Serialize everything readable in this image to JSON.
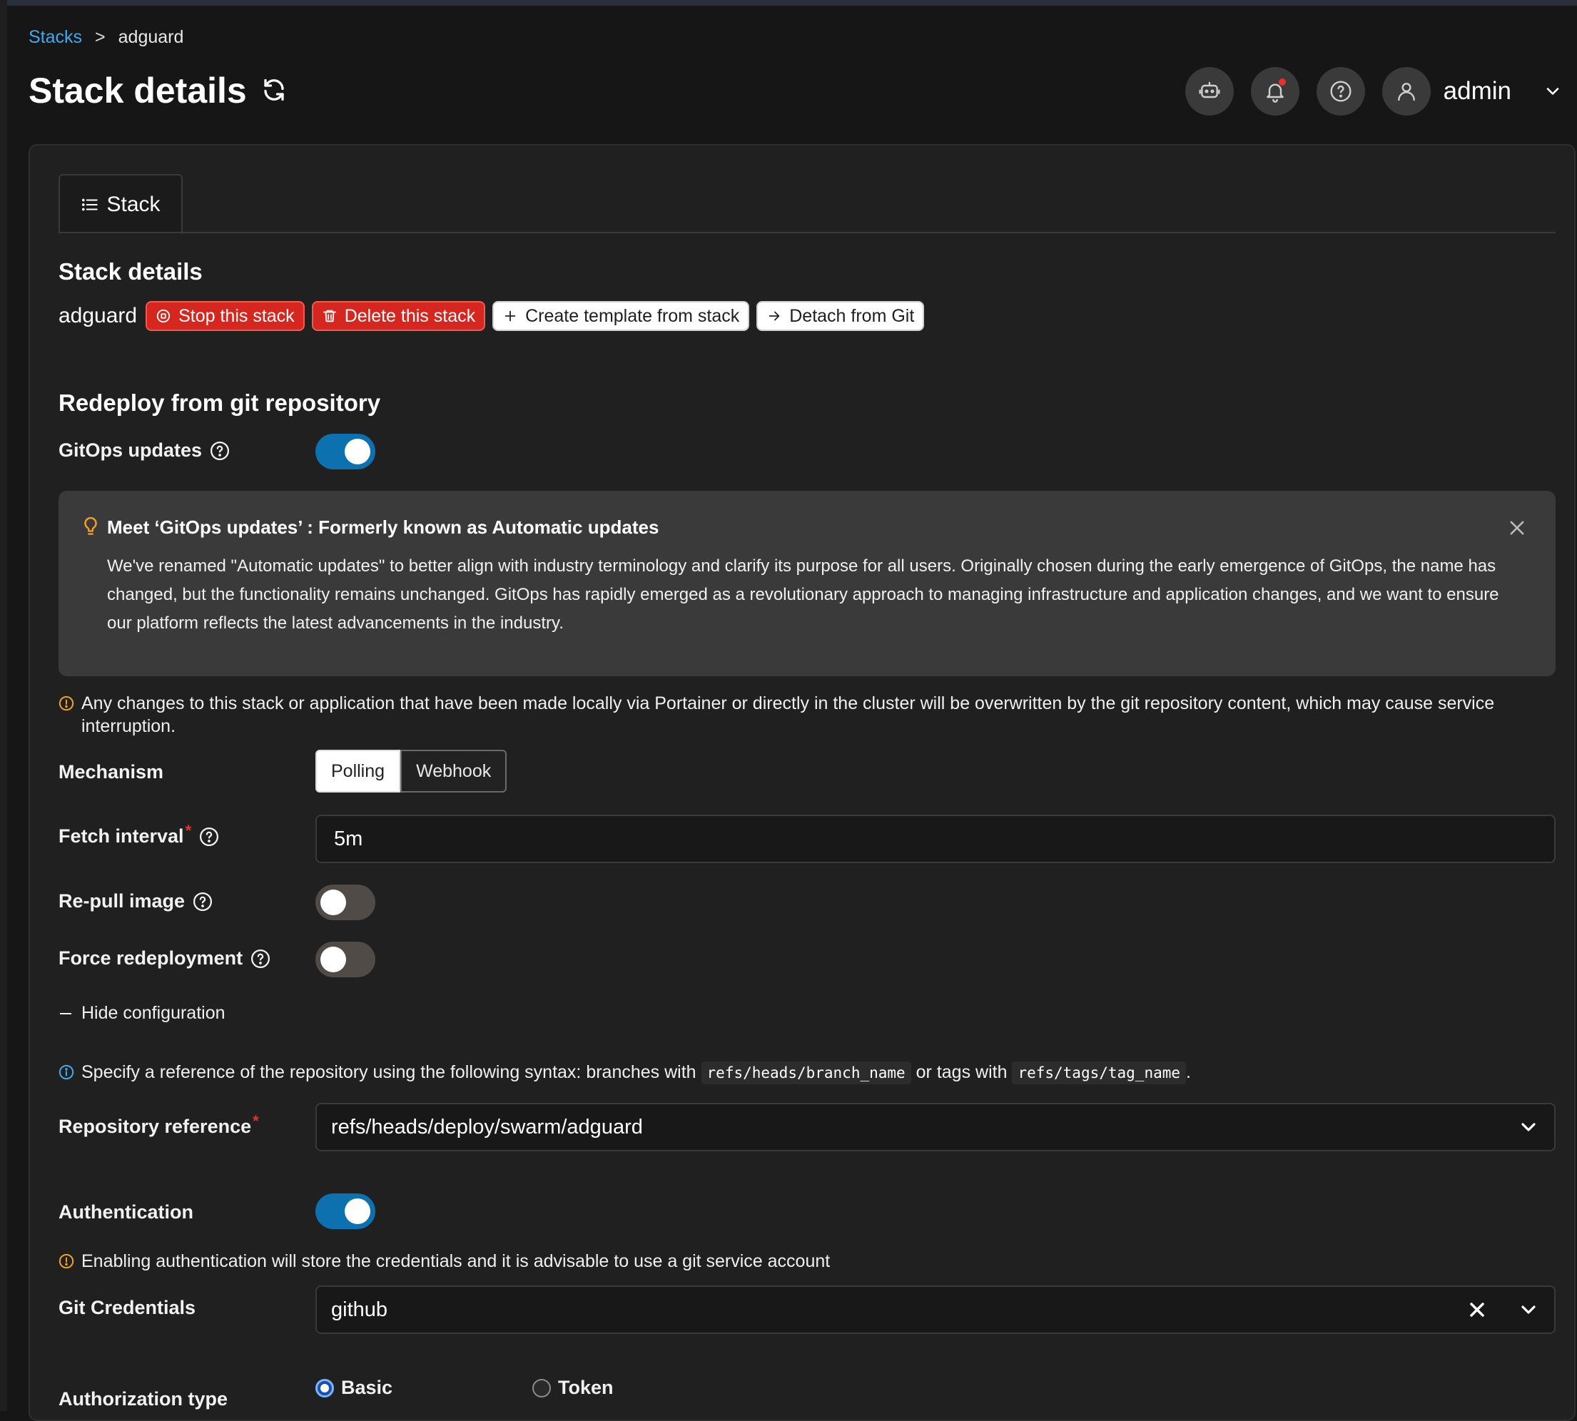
{
  "breadcrumb": {
    "parent": "Stacks",
    "separator": ">",
    "current": "adguard"
  },
  "page": {
    "title": "Stack details"
  },
  "user": {
    "name": "admin"
  },
  "tabs": [
    {
      "label": "Stack"
    }
  ],
  "stack": {
    "section_title": "Stack details",
    "name": "adguard",
    "buttons": {
      "stop": "Stop this stack",
      "delete": "Delete this stack",
      "template": "Create template from stack",
      "detach": "Detach from Git"
    }
  },
  "redeploy": {
    "title": "Redeploy from git repository",
    "gitops_label": "GitOps updates",
    "gitops_enabled": true,
    "info": {
      "title": "Meet ‘GitOps updates’ : Formerly known as Automatic updates",
      "body": "We've renamed \"Automatic updates\" to better align with industry terminology and clarify its purpose for all users. Originally chosen during the early emergence of GitOps, the name has changed, but the functionality remains unchanged. GitOps has rapidly emerged as a revolutionary approach to managing infrastructure and application changes, and we want to ensure our platform reflects the latest advancements in the industry."
    },
    "warning": "Any changes to this stack or application that have been made locally via Portainer or directly in the cluster will be overwritten by the git repository content, which may cause service interruption.",
    "mechanism_label": "Mechanism",
    "mechanism_options": [
      "Polling",
      "Webhook"
    ],
    "mechanism_selected": "Polling",
    "fetch_interval_label": "Fetch interval",
    "fetch_interval_value": "5m",
    "repull_label": "Re-pull image",
    "repull_enabled": false,
    "force_label": "Force redeployment",
    "force_enabled": false,
    "hide_config": "Hide configuration",
    "ref_hint_before": "Specify a reference of the repository using the following syntax: branches with",
    "ref_hint_branch": "refs/heads/branch_name",
    "ref_hint_middle": "or tags with",
    "ref_hint_tag": "refs/tags/tag_name",
    "ref_hint_end": ".",
    "repo_ref_label": "Repository reference",
    "repo_ref_value": "refs/heads/deploy/swarm/adguard",
    "auth_label": "Authentication",
    "auth_enabled": true,
    "auth_warning": "Enabling authentication will store the credentials and it is advisable to use a git service account",
    "git_cred_label": "Git Credentials",
    "git_cred_value": "github",
    "authz_label": "Authorization type",
    "authz_options": [
      "Basic",
      "Token"
    ],
    "authz_selected": "Basic",
    "required_mark": "*"
  },
  "colors": {
    "accent": "#0d71b0",
    "danger": "#d5261f",
    "link": "#3ea8f1",
    "warning": "#f0a020",
    "info": "#3ea8f1"
  },
  "icons": [
    "refresh-icon",
    "ai-bot-icon",
    "bell-icon",
    "help-icon",
    "user-icon",
    "chevron-down-icon",
    "list-icon",
    "stop-icon",
    "trash-icon",
    "plus-icon",
    "arrow-right-icon",
    "lightbulb-icon",
    "close-icon",
    "warning-circle-icon",
    "info-circle-icon"
  ]
}
